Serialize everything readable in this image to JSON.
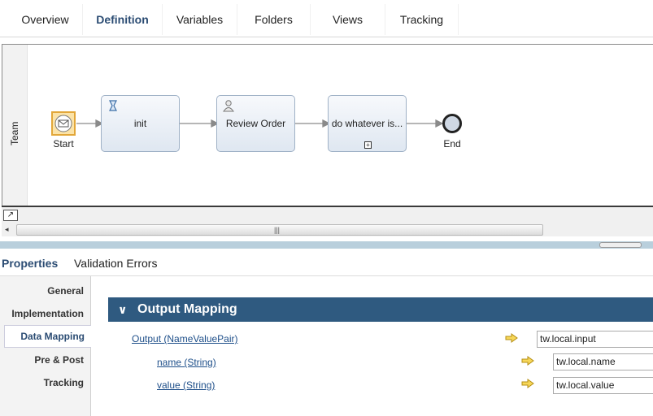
{
  "tabs": [
    "Overview",
    "Definition",
    "Variables",
    "Folders",
    "Views",
    "Tracking"
  ],
  "active_tab": "Definition",
  "diagram": {
    "lane": "Team",
    "start": "Start",
    "init": "init",
    "review": "Review Order",
    "subprocess": "do whatever is...",
    "end": "End"
  },
  "properties": {
    "tabs": [
      "Properties",
      "Validation Errors"
    ],
    "nav": [
      "General",
      "Implementation",
      "Data Mapping",
      "Pre & Post",
      "Tracking"
    ],
    "active_nav": "Data Mapping"
  },
  "output_mapping": {
    "title": "Output Mapping",
    "rows": [
      {
        "label": "Output (NameValuePair)",
        "value": "tw.local.input"
      },
      {
        "label": "name (String)",
        "value": "tw.local.name"
      },
      {
        "label": "value (String)",
        "value": "tw.local.value"
      }
    ]
  },
  "colors": {
    "accent": "#2f5a80",
    "active_text": "#2b4c73",
    "link": "#1d4e89",
    "arrow": "#f2c230"
  }
}
